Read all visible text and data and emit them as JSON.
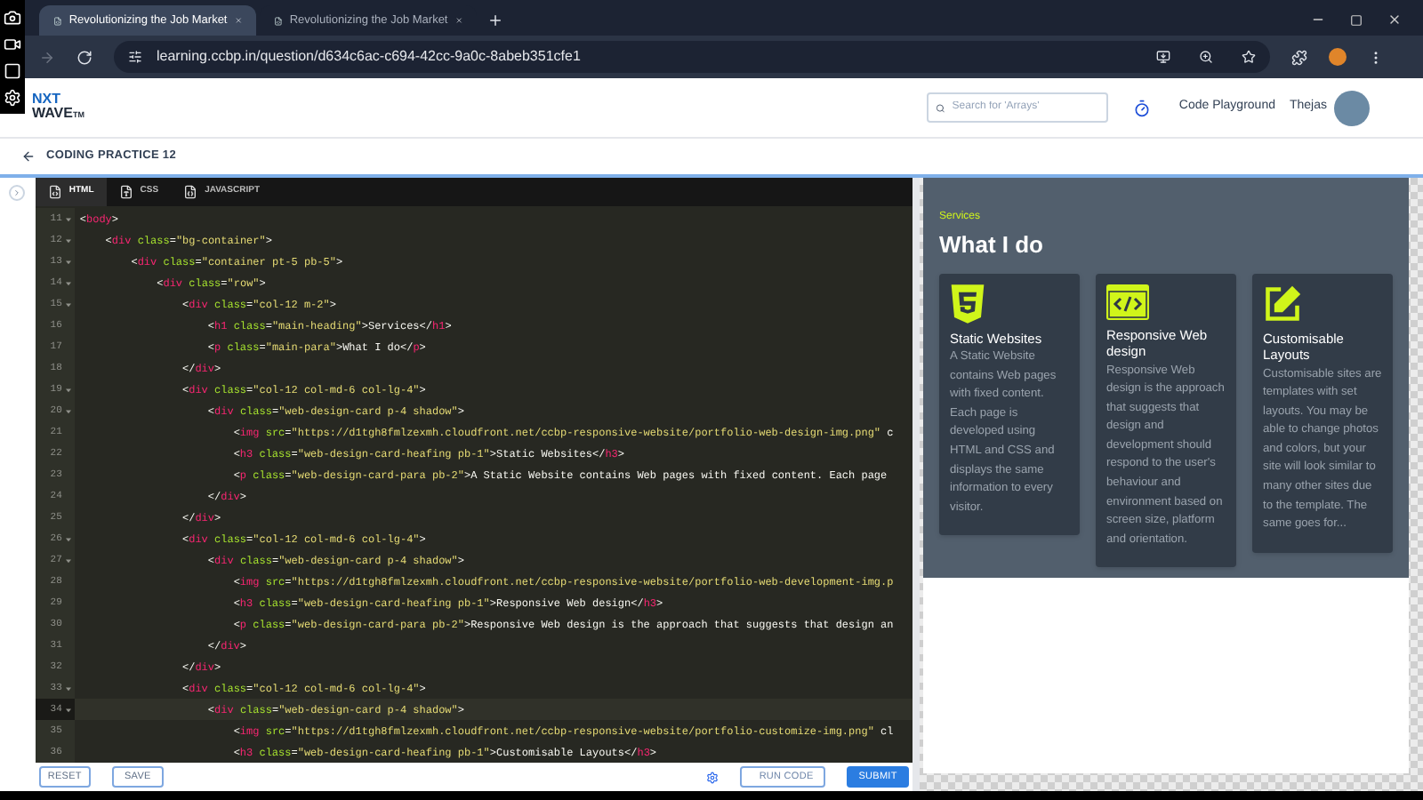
{
  "browser": {
    "tabs": [
      {
        "title": "Revolutionizing the Job Market",
        "selected": true
      },
      {
        "title": "Revolutionizing the Job Market",
        "selected": false
      }
    ],
    "url": "learning.ccbp.in/question/d634c6ac-c694-42cc-9a0c-8abeb351cfe1"
  },
  "header": {
    "logo": {
      "top": "NXT",
      "bottom": "WAVE",
      "mark": "TM"
    },
    "search": {
      "placeholder": "Search for 'Arrays'"
    },
    "nav_link": "Code Playground",
    "user": "Thejas"
  },
  "breadcrumb": "CODING PRACTICE 12",
  "editor": {
    "tabs": [
      {
        "label": "HTML",
        "kind": "html",
        "selected": true
      },
      {
        "label": "CSS",
        "kind": "css",
        "selected": false
      },
      {
        "label": "JAVASCRIPT",
        "kind": "js",
        "selected": false
      }
    ],
    "lines": [
      {
        "number": "11",
        "foldable": true,
        "selected": false,
        "text": "<body>"
      },
      {
        "number": "12",
        "foldable": true,
        "selected": false,
        "text": "    <div class=\"bg-container\">"
      },
      {
        "number": "13",
        "foldable": true,
        "selected": false,
        "text": "        <div class=\"container pt-5 pb-5\">"
      },
      {
        "number": "14",
        "foldable": true,
        "selected": false,
        "text": "            <div class=\"row\">"
      },
      {
        "number": "15",
        "foldable": true,
        "selected": false,
        "text": "                <div class=\"col-12 m-2\">"
      },
      {
        "number": "16",
        "foldable": false,
        "selected": false,
        "text": "                    <h1 class=\"main-heading\">Services</h1>"
      },
      {
        "number": "17",
        "foldable": false,
        "selected": false,
        "text": "                    <p class=\"main-para\">What I do</p>"
      },
      {
        "number": "18",
        "foldable": false,
        "selected": false,
        "text": "                </div>"
      },
      {
        "number": "19",
        "foldable": true,
        "selected": false,
        "text": "                <div class=\"col-12 col-md-6 col-lg-4\">"
      },
      {
        "number": "20",
        "foldable": true,
        "selected": false,
        "text": "                    <div class=\"web-design-card p-4 shadow\">"
      },
      {
        "number": "21",
        "foldable": false,
        "selected": false,
        "text": "                        <img src=\"https://d1tgh8fmlzexmh.cloudfront.net/ccbp-responsive-website/portfolio-web-design-img.png\" c"
      },
      {
        "number": "22",
        "foldable": false,
        "selected": false,
        "text": "                        <h3 class=\"web-design-card-heafing pb-1\">Static Websites</h3>"
      },
      {
        "number": "23",
        "foldable": false,
        "selected": false,
        "text": "                        <p class=\"web-design-card-para pb-2\">A Static Website contains Web pages with fixed content. Each page"
      },
      {
        "number": "24",
        "foldable": false,
        "selected": false,
        "text": "                    </div>"
      },
      {
        "number": "25",
        "foldable": false,
        "selected": false,
        "text": "                </div>"
      },
      {
        "number": "26",
        "foldable": true,
        "selected": false,
        "text": "                <div class=\"col-12 col-md-6 col-lg-4\">"
      },
      {
        "number": "27",
        "foldable": true,
        "selected": false,
        "text": "                    <div class=\"web-design-card p-4 shadow\">"
      },
      {
        "number": "28",
        "foldable": false,
        "selected": false,
        "text": "                        <img src=\"https://d1tgh8fmlzexmh.cloudfront.net/ccbp-responsive-website/portfolio-web-development-img.p"
      },
      {
        "number": "29",
        "foldable": false,
        "selected": false,
        "text": "                        <h3 class=\"web-design-card-heafing pb-1\">Responsive Web design</h3>"
      },
      {
        "number": "30",
        "foldable": false,
        "selected": false,
        "text": "                        <p class=\"web-design-card-para pb-2\">Responsive Web design is the approach that suggests that design an"
      },
      {
        "number": "31",
        "foldable": false,
        "selected": false,
        "text": "                    </div>"
      },
      {
        "number": "32",
        "foldable": false,
        "selected": false,
        "text": "                </div>"
      },
      {
        "number": "33",
        "foldable": true,
        "selected": false,
        "text": "                <div class=\"col-12 col-md-6 col-lg-4\">"
      },
      {
        "number": "34",
        "foldable": true,
        "selected": true,
        "text": "                    <div class=\"web-design-card p-4 shadow\">"
      },
      {
        "number": "35",
        "foldable": false,
        "selected": false,
        "text": "                        <img src=\"https://d1tgh8fmlzexmh.cloudfront.net/ccbp-responsive-website/portfolio-customize-img.png\" cl"
      },
      {
        "number": "36",
        "foldable": false,
        "selected": false,
        "text": "                        <h3 class=\"web-design-card-heafing pb-1\">Customisable Layouts</h3>"
      }
    ],
    "buttons": [
      {
        "label": "RESET",
        "kind": "outline"
      },
      {
        "label": "SAVE",
        "kind": "outline"
      },
      {
        "label": "RUN CODE",
        "kind": "run"
      },
      {
        "label": "SUBMIT",
        "kind": "primary"
      }
    ]
  },
  "preview": {
    "label": "Services",
    "heading": "What I do",
    "cards": [
      {
        "kind": "html5",
        "title": "Static Websites",
        "text": "A Static Website contains Web pages with fixed content. Each page is developed using HTML and CSS and displays the same information to every visitor."
      },
      {
        "kind": "code",
        "title": "Responsive Web design",
        "text": "Responsive Web design is the approach that suggests that design and development should respond to the user's behaviour and environment based on screen size, platform and orientation."
      },
      {
        "kind": "edit",
        "title": "Customisable Layouts",
        "text": "Customisable sites are templates with set layouts. You may be able to change photos and colors, but your site will look similar to many other sites due to the template. The same goes for..."
      }
    ]
  }
}
